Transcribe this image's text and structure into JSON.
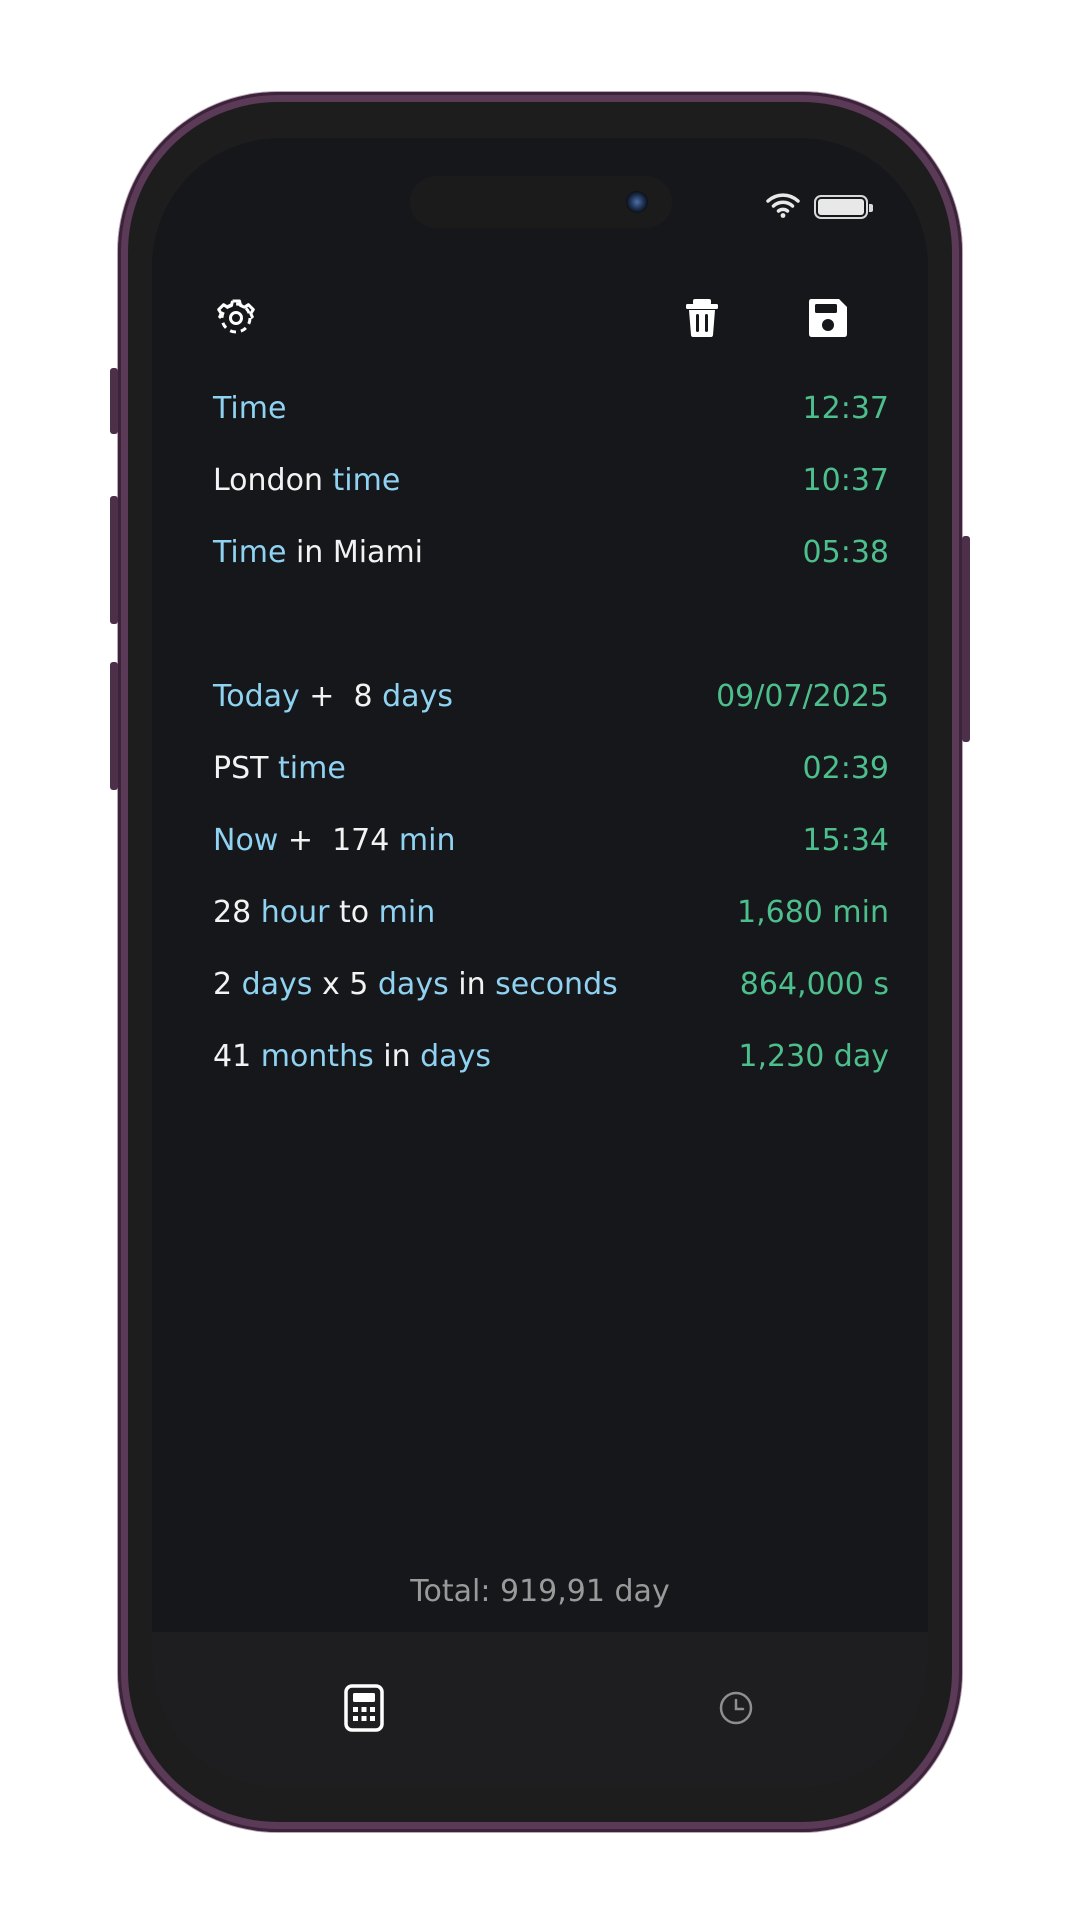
{
  "status_bar": {
    "wifi_icon": "wifi-icon",
    "battery_icon": "battery-icon"
  },
  "toolbar": {
    "settings_icon": "gear-icon",
    "delete_icon": "trash-icon",
    "save_icon": "floppy-disk-icon"
  },
  "colors": {
    "keyword": "#8fd2f2",
    "plain_text": "#f3f3f3",
    "result": "#4dbf8d",
    "background": "#16171a"
  },
  "entries": [
    {
      "parts": [
        {
          "t": "Time",
          "k": true
        }
      ],
      "result": "12:37"
    },
    {
      "parts": [
        {
          "t": "London ",
          "k": false
        },
        {
          "t": "time",
          "k": true
        }
      ],
      "result": "10:37"
    },
    {
      "parts": [
        {
          "t": "Time",
          "k": true
        },
        {
          "t": " in Miami",
          "k": false
        }
      ],
      "result": "05:38"
    },
    {
      "parts": [
        {
          "t": "Today",
          "k": true
        },
        {
          "t": " +  8 ",
          "k": false
        },
        {
          "t": "days",
          "k": true
        }
      ],
      "result": "09/07/2025"
    },
    {
      "parts": [
        {
          "t": "PST ",
          "k": false
        },
        {
          "t": "time",
          "k": true
        }
      ],
      "result": "02:39"
    },
    {
      "parts": [
        {
          "t": "Now",
          "k": true
        },
        {
          "t": " +  174 ",
          "k": false
        },
        {
          "t": "min",
          "k": true
        }
      ],
      "result": "15:34"
    },
    {
      "parts": [
        {
          "t": "28 ",
          "k": false
        },
        {
          "t": "hour",
          "k": true
        },
        {
          "t": " to ",
          "k": false
        },
        {
          "t": "min",
          "k": true
        }
      ],
      "result": "1,680 min"
    },
    {
      "parts": [
        {
          "t": "2 ",
          "k": false
        },
        {
          "t": "days",
          "k": true
        },
        {
          "t": " x 5 ",
          "k": false
        },
        {
          "t": "days",
          "k": true
        },
        {
          "t": " in ",
          "k": false
        },
        {
          "t": "seconds",
          "k": true
        }
      ],
      "result": "864,000 s"
    },
    {
      "parts": [
        {
          "t": "41 ",
          "k": false
        },
        {
          "t": "months",
          "k": true
        },
        {
          "t": " in ",
          "k": false
        },
        {
          "t": "days",
          "k": true
        }
      ],
      "result": "1,230 day"
    }
  ],
  "footer": {
    "total": "Total: 919,91 day"
  },
  "tabs": [
    {
      "icon": "calculator-icon",
      "active": true
    },
    {
      "icon": "clock-icon",
      "active": false
    }
  ]
}
